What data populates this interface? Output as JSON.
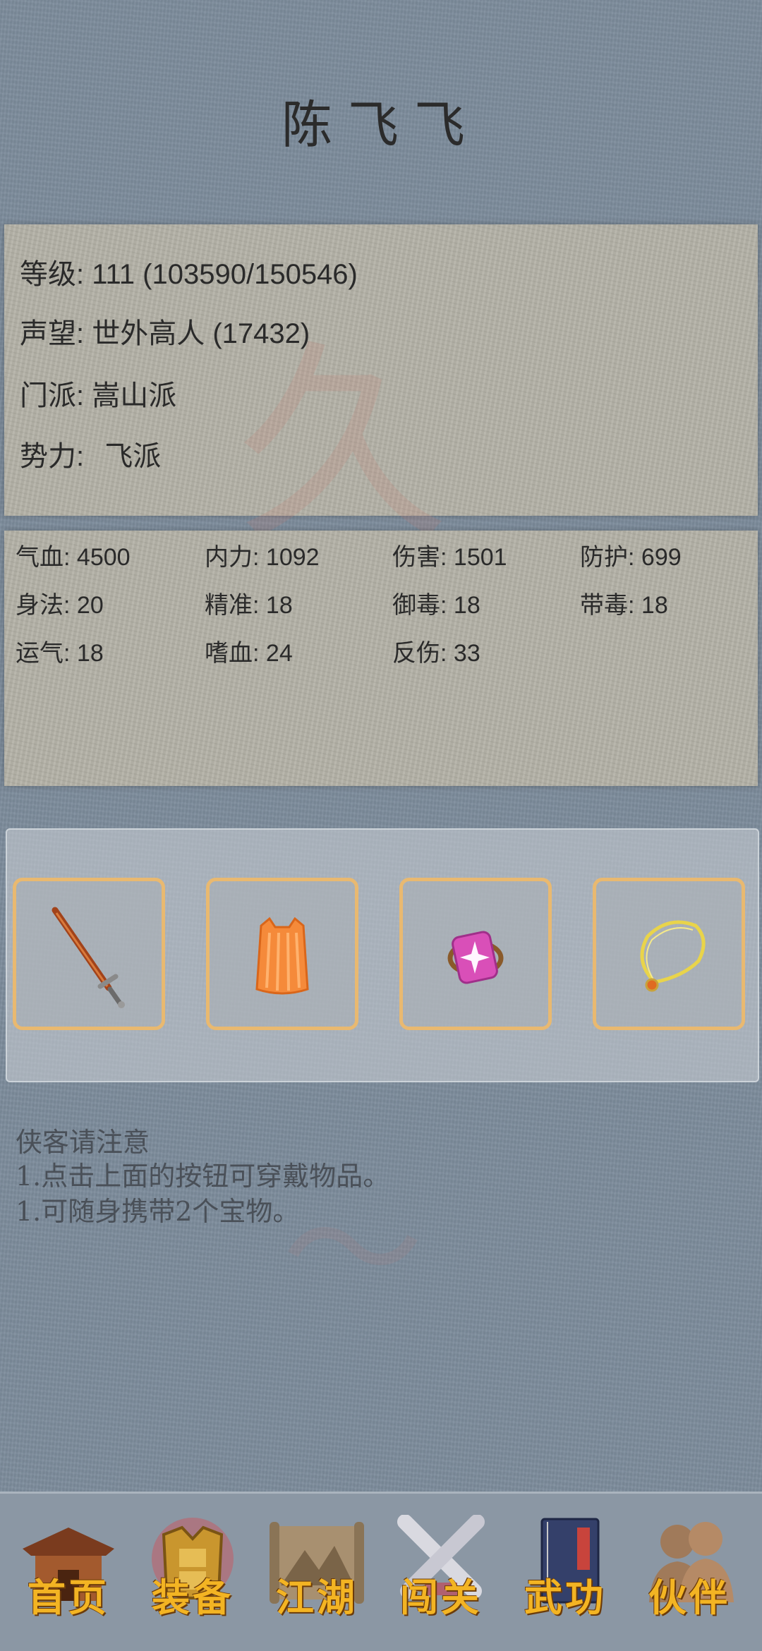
{
  "character": {
    "name": "陈飞飞"
  },
  "info": {
    "level_label": "等级:",
    "level_value": "111 (103590/150546)",
    "fame_label": "声望:",
    "fame_value": "世外高人 (17432)",
    "sect_label": "门派:",
    "sect_value": "嵩山派",
    "faction_label": "势力:",
    "faction_value": "飞派"
  },
  "stats": [
    {
      "label": "气血:",
      "value": "4500"
    },
    {
      "label": "内力:",
      "value": "1092"
    },
    {
      "label": "伤害:",
      "value": "1501"
    },
    {
      "label": "防护:",
      "value": "699"
    },
    {
      "label": "身法:",
      "value": "20"
    },
    {
      "label": "精准:",
      "value": "18"
    },
    {
      "label": "御毒:",
      "value": "18"
    },
    {
      "label": "带毒:",
      "value": "18"
    },
    {
      "label": "运气:",
      "value": "18"
    },
    {
      "label": "嗜血:",
      "value": "24"
    },
    {
      "label": "反伤:",
      "value": "33"
    }
  ],
  "equipment": [
    {
      "icon": "sword-icon"
    },
    {
      "icon": "armor-icon"
    },
    {
      "icon": "ring-icon"
    },
    {
      "icon": "necklace-icon"
    }
  ],
  "notice": {
    "title": "侠客请注意",
    "line1": "1.点击上面的按钮可穿戴物品。",
    "line2": "1.可随身携带2个宝物。"
  },
  "nav": [
    {
      "label": "首页",
      "icon": "house-icon"
    },
    {
      "label": "装备",
      "icon": "armor-icon",
      "active": true
    },
    {
      "label": "江湖",
      "icon": "scroll-map-icon"
    },
    {
      "label": "闯关",
      "icon": "crossed-swords-icon"
    },
    {
      "label": "武功",
      "icon": "book-icon"
    },
    {
      "label": "伙伴",
      "icon": "partners-icon"
    }
  ],
  "colors": {
    "accent": "#f3b423",
    "slot_border": "#e9b970",
    "background": "#7d8c9c"
  }
}
